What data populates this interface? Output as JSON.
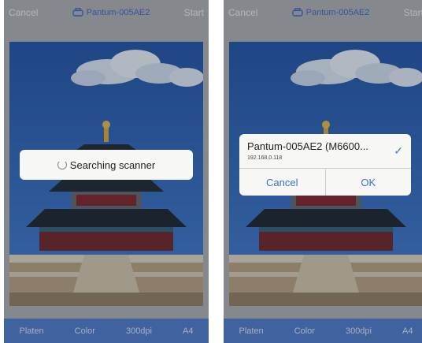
{
  "colors": {
    "accent": "#4a78c8",
    "link": "#3b6fd0",
    "chrome": "#a9acb0"
  },
  "left": {
    "topbar": {
      "cancel": "Cancel",
      "title": "Pantum-005AE2",
      "start": "Start",
      "icon": "scanner-icon"
    },
    "hud": {
      "text": "Searching scanner"
    },
    "bottombar": {
      "items": [
        "Platen",
        "Color",
        "300dpi",
        "A4"
      ]
    }
  },
  "right": {
    "topbar": {
      "cancel": "Cancel",
      "title": "Pantum-005AE2",
      "start": "Start",
      "icon": "scanner-icon"
    },
    "alert": {
      "device_name": "Pantum-005AE2 (M6600...",
      "device_ip": "192.168.0.118",
      "cancel": "Cancel",
      "ok": "OK",
      "check_icon": "checkmark-icon"
    },
    "bottombar": {
      "items": [
        "Platen",
        "Color",
        "300dpi",
        "A4"
      ]
    }
  }
}
